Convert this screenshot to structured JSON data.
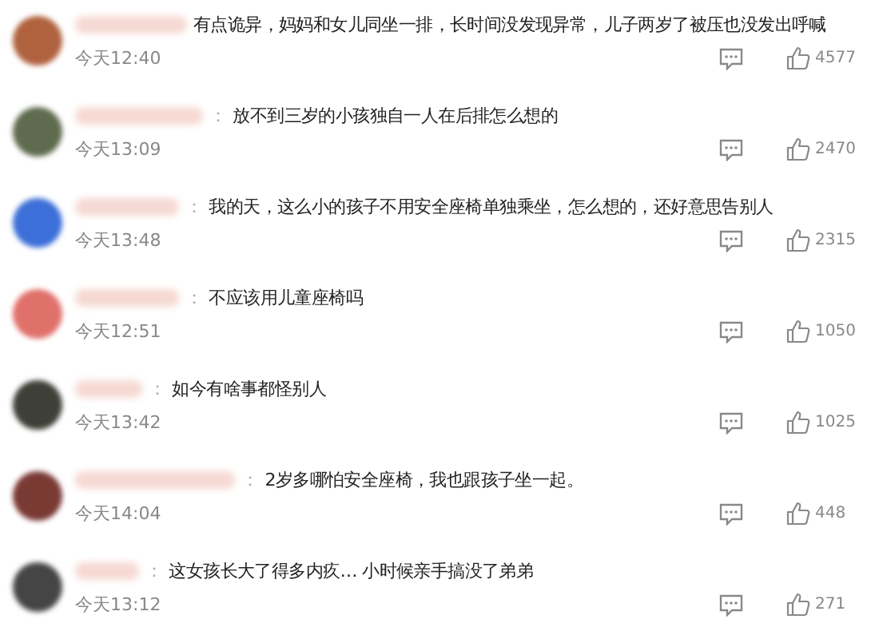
{
  "comments": [
    {
      "color": "#b0623f",
      "text": "有点诡异，妈妈和女儿同坐一排，长时间没发现异常，儿子两岁了被压也没发出呼喊",
      "time": "今天12:40",
      "likes": "4577"
    },
    {
      "color": "#5e6b4e",
      "separator": "：",
      "text": "放不到三岁的小孩独自一人在后排怎么想的",
      "time": "今天13:09",
      "likes": "2470"
    },
    {
      "color": "#3d6fd8",
      "separator": "：",
      "text": "我的天，这么小的孩子不用安全座椅单独乘坐，怎么想的，还好意思告别人",
      "time": "今天13:48",
      "likes": "2315"
    },
    {
      "color": "#e0706a",
      "separator": "：",
      "text": "不应该用儿童座椅吗",
      "time": "今天12:51",
      "likes": "1050"
    },
    {
      "color": "#3e3f36",
      "separator": "：",
      "text": "如今有啥事都怪别人",
      "time": "今天13:42",
      "likes": "1025"
    },
    {
      "color": "#7a3a34",
      "separator": "：",
      "text": "2岁多哪怕安全座椅，我也跟孩子坐一起。",
      "time": "今天14:04",
      "likes": "448"
    },
    {
      "color": "#454545",
      "separator": "：",
      "text": "这女孩长大了得多内疚… 小时候亲手搞没了弟弟",
      "time": "今天13:12",
      "likes": "271"
    }
  ]
}
